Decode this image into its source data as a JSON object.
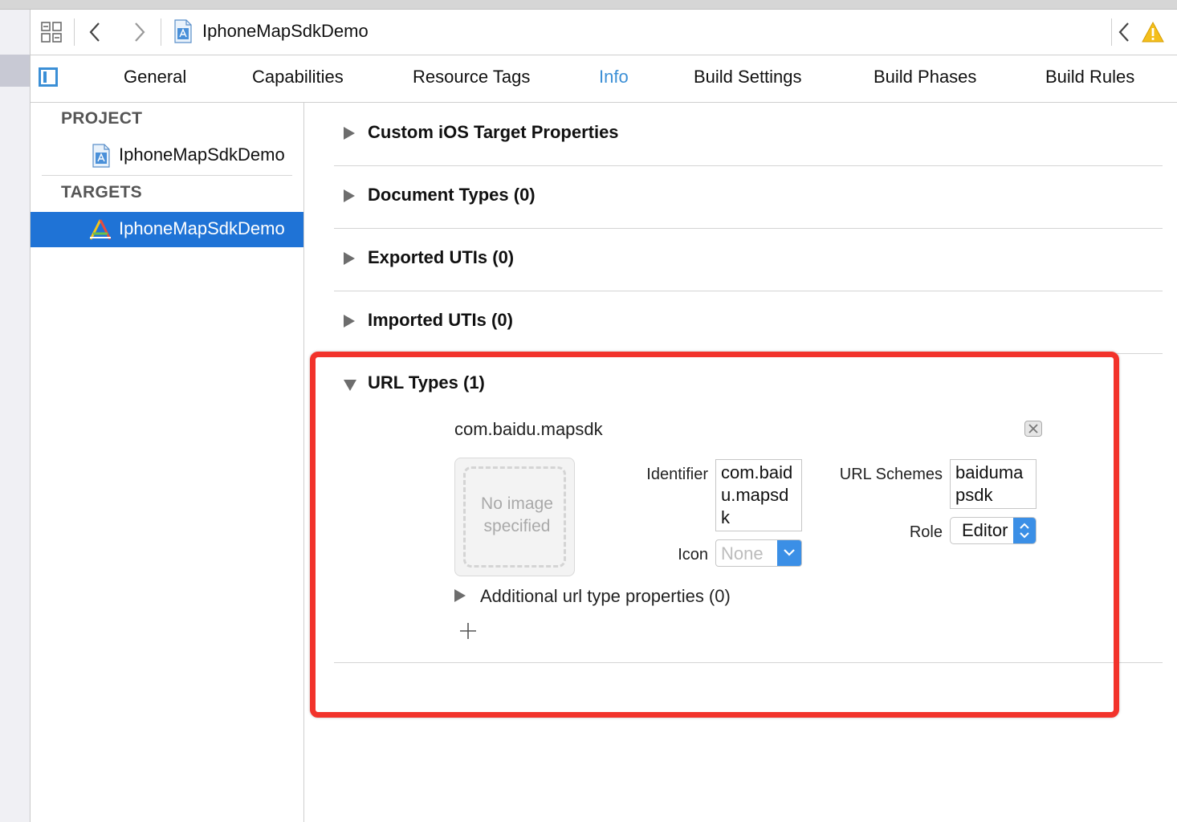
{
  "jumpbar": {
    "title": "IphoneMapSdkDemo",
    "left_icons": [
      "grid-icon",
      "back-icon",
      "forward-icon",
      "project-file-icon"
    ],
    "right_icons": [
      "back-icon",
      "warning-icon"
    ]
  },
  "tabs": [
    {
      "label": "General",
      "active": false
    },
    {
      "label": "Capabilities",
      "active": false
    },
    {
      "label": "Resource Tags",
      "active": false
    },
    {
      "label": "Info",
      "active": true
    },
    {
      "label": "Build Settings",
      "active": false
    },
    {
      "label": "Build Phases",
      "active": false
    },
    {
      "label": "Build Rules",
      "active": false
    }
  ],
  "sidebar": {
    "project_header": "PROJECT",
    "project_item": "IphoneMapSdkDemo",
    "targets_header": "TARGETS",
    "target_item": "IphoneMapSdkDemo"
  },
  "sections": [
    {
      "title": "Custom iOS Target Properties",
      "expanded": false
    },
    {
      "title": "Document Types (0)",
      "expanded": false
    },
    {
      "title": "Exported UTIs (0)",
      "expanded": false
    },
    {
      "title": "Imported UTIs (0)",
      "expanded": false
    }
  ],
  "url_types": {
    "title": "URL Types (1)",
    "item": {
      "name": "com.baidu.mapsdk",
      "image_placeholder": "No image specified",
      "identifier_label": "Identifier",
      "identifier_value": "com.baidu.mapsdk",
      "icon_label": "Icon",
      "icon_value": "None",
      "url_schemes_label": "URL Schemes",
      "url_schemes_value": "baidumapsdk",
      "role_label": "Role",
      "role_value": "Editor",
      "additional_label": "Additional url type properties (0)"
    }
  },
  "colors": {
    "accent": "#3b8fd6",
    "selection": "#1f73d6",
    "highlight": "#f2332b"
  }
}
